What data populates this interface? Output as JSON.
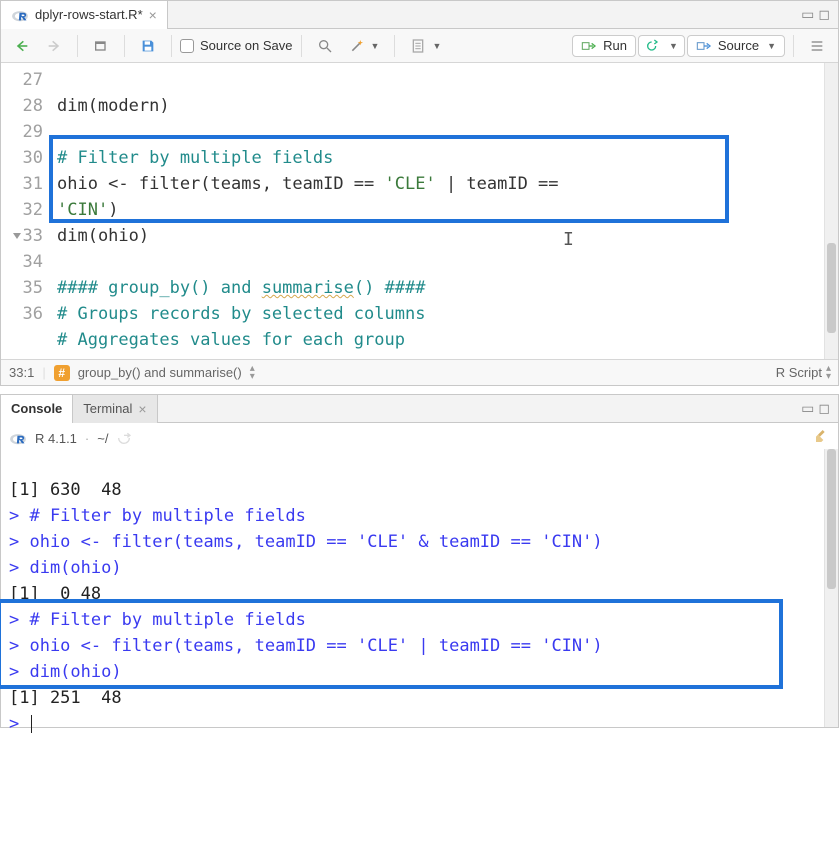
{
  "editor": {
    "file_tab": {
      "label": "dplyr-rows-start.R*"
    },
    "toolbar": {
      "source_on_save": "Source on Save",
      "run": "Run",
      "source": "Source"
    },
    "gutter": [
      "27",
      "28",
      "29",
      "30",
      "",
      "31",
      "32",
      "33",
      "34",
      "35",
      "36"
    ],
    "lines": {
      "l27": "dim(modern)",
      "l28": "",
      "l29": "# Filter by multiple fields",
      "l30a": "ohio <- filter(teams, teamID == ",
      "l30s1": "'CLE'",
      "l30b": " | teamID == ",
      "l30s2": "'CIN'",
      "l30c": ")",
      "l31": "dim(ohio)",
      "l32": "",
      "l33a": "#### group_by() and ",
      "l33b": "summarise",
      "l33c": "() ####",
      "l34": "# Groups records by selected columns",
      "l35": "# Aggregates values for each group",
      "l36": ""
    },
    "status": {
      "cursor": "33:1",
      "section": "group_by() and summarise()",
      "lang": "R Script"
    }
  },
  "console": {
    "tabs": {
      "console": "Console",
      "terminal": "Terminal"
    },
    "info": {
      "version": "R 4.1.1",
      "cwd": "~/"
    },
    "lines": {
      "o1": "[1] 630  48",
      "i1": "> # Filter by multiple fields",
      "i2": "> ohio <- filter(teams, teamID == 'CLE' & teamID == 'CIN')",
      "i3": "> dim(ohio)",
      "o2": "[1]  0 48",
      "i4": "> # Filter by multiple fields",
      "i5": "> ohio <- filter(teams, teamID == 'CLE' | teamID == 'CIN')",
      "i6": "> dim(ohio)",
      "o3": "[1] 251  48",
      "prompt": "> "
    }
  }
}
